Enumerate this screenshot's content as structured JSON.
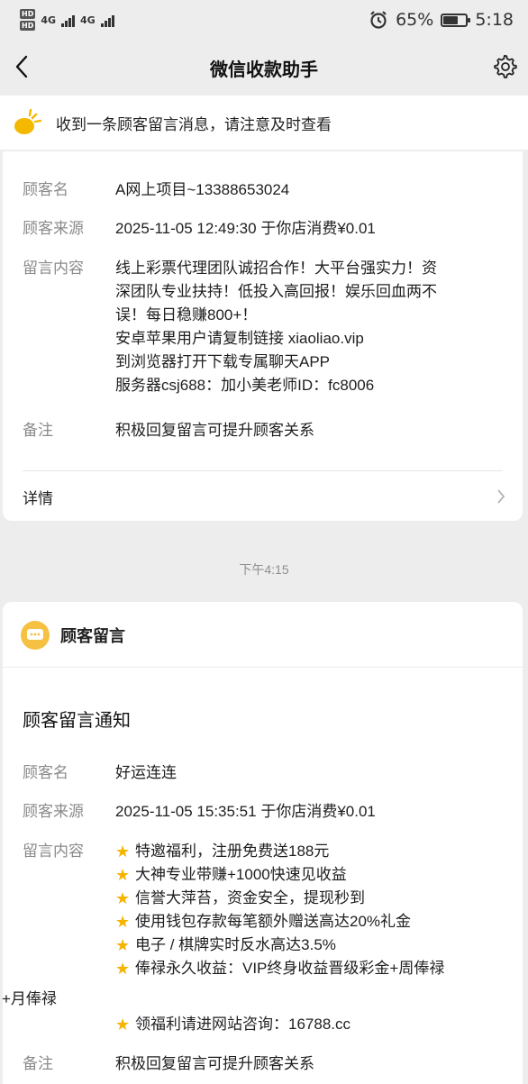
{
  "status_bar": {
    "hd_badges": [
      "HD",
      "HD"
    ],
    "signal_labels": [
      "4G",
      "4G"
    ],
    "battery_percent_text": "65%",
    "battery_level": 0.65,
    "time": "5:18"
  },
  "nav": {
    "title": "微信收款助手"
  },
  "notice": {
    "text": "收到一条顾客留言消息，请注意及时查看"
  },
  "card1": {
    "rows": [
      {
        "label": "顾客名",
        "value": "A网上项目~13388653024"
      },
      {
        "label": "顾客来源",
        "value": "2025-11-05 12:49:30 于你店消费¥0.01"
      },
      {
        "label": "留言内容",
        "value": "线上彩票代理团队诚招合作！大平台强实力！资\n深团队专业扶持！低投入高回报！娱乐回血两不\n误！每日稳赚800+！\n安卓苹果用户请复制链接 xiaoliao.vip\n到浏览器打开下载专属聊天APP\n服务器csj688：加小美老师ID：fc8006"
      },
      {
        "label": "备注",
        "value": "积极回复留言可提升顾客关系"
      }
    ],
    "detail_label": "详情"
  },
  "timestamp": "下午4:15",
  "card2": {
    "header": "顾客留言",
    "title": "顾客留言通知",
    "name_label": "顾客名",
    "name_value": "好运连连",
    "source_label": "顾客来源",
    "source_value": "2025-11-05 15:35:51 于你店消费¥0.01",
    "content_label": "留言内容",
    "content_lines": [
      "特邀福利，注册免费送188元",
      "大神专业带赚+1000快速见收益",
      "信誉大萍苔，资金安全，提现秒到",
      "使用钱包存款每笔额外赠送高达20%礼金",
      "电子 / 棋牌实时反水高达3.5%",
      "俸禄永久收益：VIP终身收益晋级彩金+周俸禄",
      "领福利请进网站咨询：16788.cc"
    ],
    "content_wrap_line": "+月俸禄",
    "remark_label": "备注",
    "remark_value": "积极回复留言可提升顾客关系"
  }
}
